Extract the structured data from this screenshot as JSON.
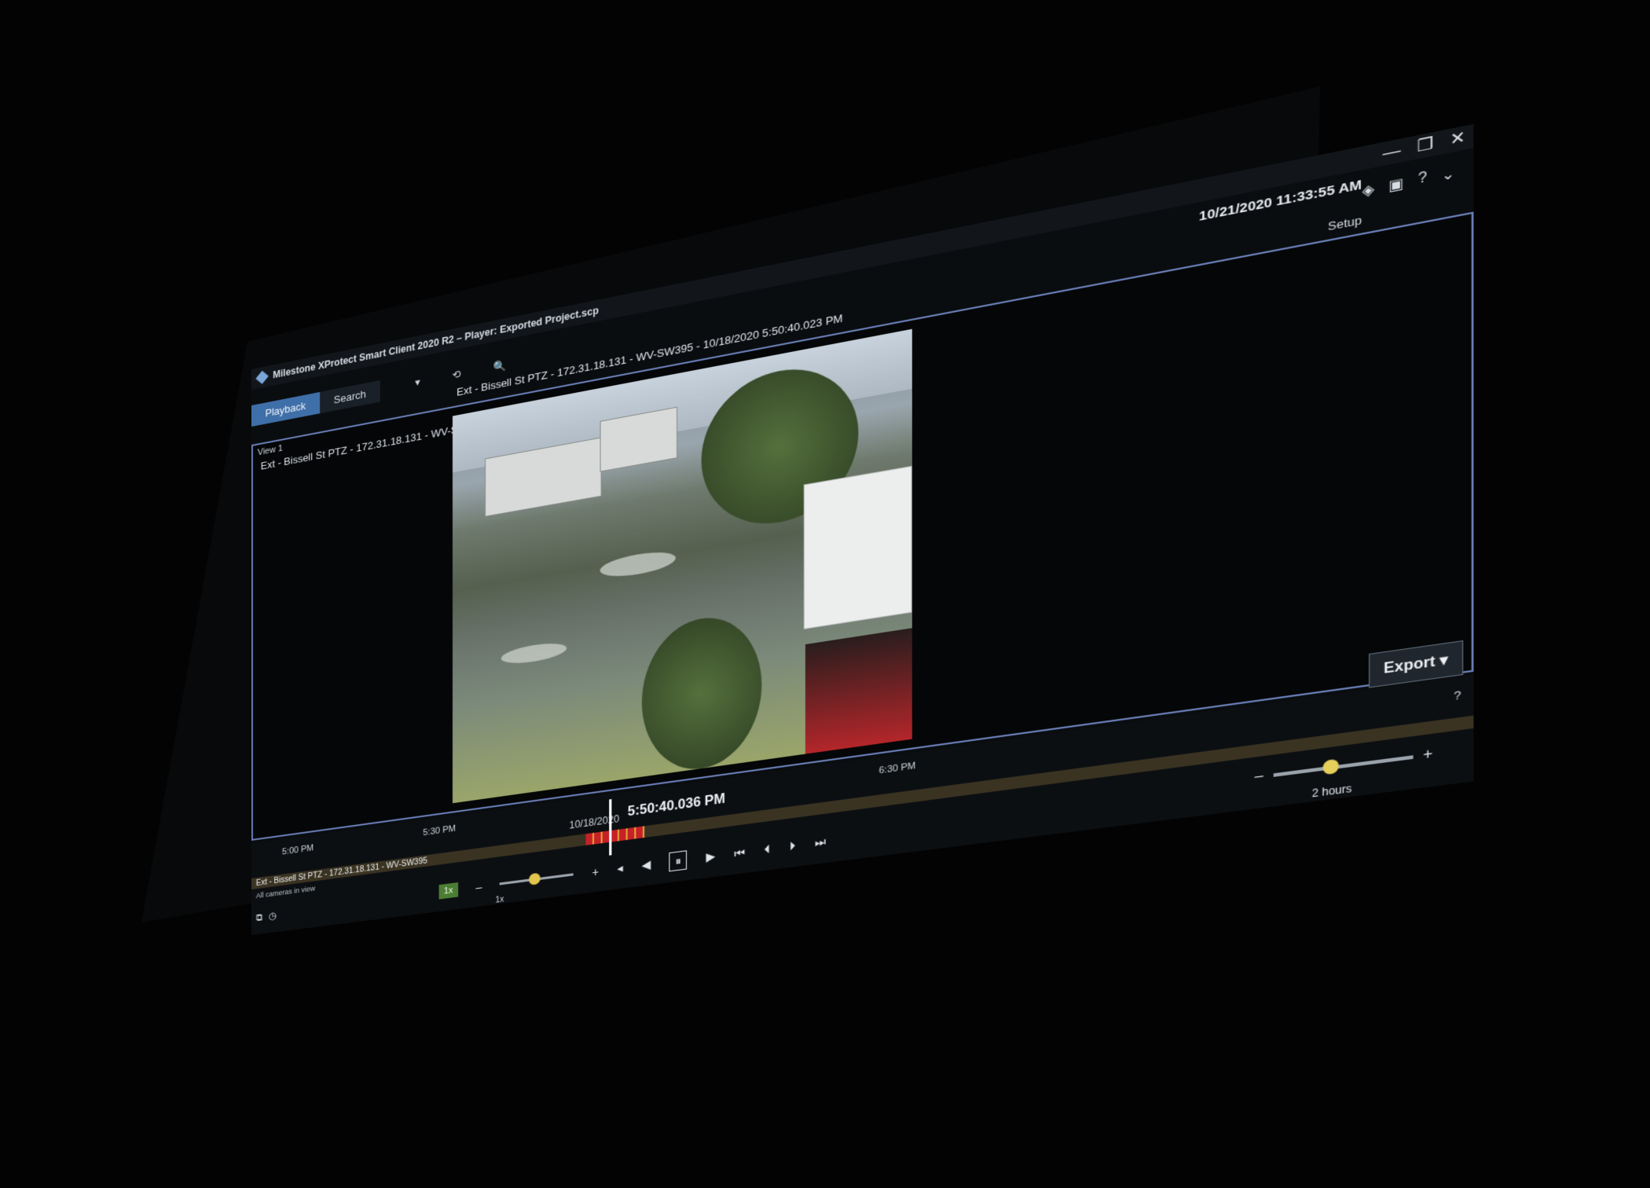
{
  "window": {
    "title": "Milestone XProtect Smart Client 2020 R2 – Player: Exported Project.scp",
    "controls": [
      "—",
      "❐",
      "✕"
    ],
    "clock": "10/21/2020 11:33:55 AM"
  },
  "tabs": [
    {
      "label": "Playback",
      "active": true
    },
    {
      "label": "Search",
      "active": false
    }
  ],
  "tab_tools": [
    "▾",
    "⟲",
    "🔍"
  ],
  "setup_label": "Setup",
  "view": {
    "label": "View 1",
    "camera_title": "Ext - Bissell St PTZ - 172.31.18.131 - WV-SW395",
    "timestamp": "Ext - Bissell St PTZ - 172.31.18.131 - WV-SW395 - 10/18/2020 5:50:40.023 PM"
  },
  "timeline": {
    "ticks": [
      "5:00 PM",
      "5:30 PM",
      "6:30 PM"
    ],
    "date": "10/18/2020",
    "current_time": "5:50:40.036 PM",
    "help": "?",
    "track_label": "Ext - Bissell St PTZ - 172.31.18.131 - WV-SW395",
    "all_cameras_label": "All cameras in view"
  },
  "controls": {
    "speed_button": "1x",
    "minus": "–",
    "plus": "+",
    "speed_label": "1x",
    "buttons": [
      "◂",
      "◀",
      "⏸",
      "▶",
      "⏮",
      "⏴",
      "⏵",
      "⏭"
    ]
  },
  "zoom": {
    "minus": "–",
    "plus": "+",
    "label": "2 hours"
  },
  "export_label": "Export ▾",
  "icons": {
    "app": "milestone-logo-icon",
    "view": "view-icon",
    "camera": "camera-icon"
  }
}
